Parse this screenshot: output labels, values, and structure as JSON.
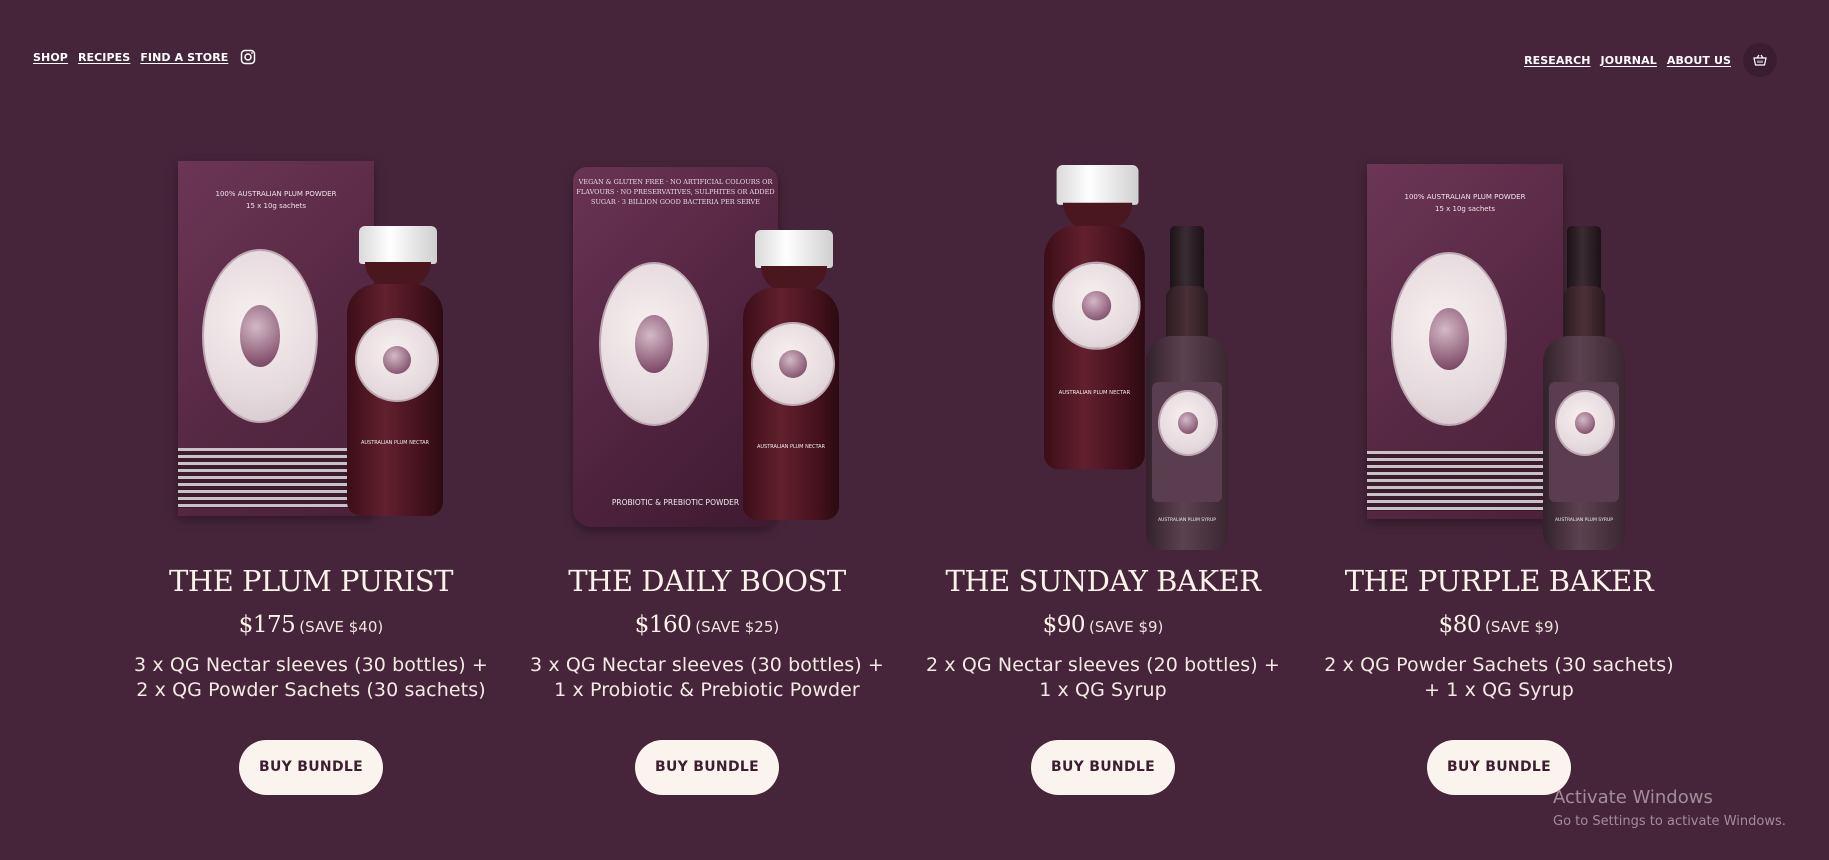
{
  "nav": {
    "left": [
      "SHOP",
      "RECIPES",
      "FIND A STORE"
    ],
    "right": [
      "RESEARCH",
      "JOURNAL",
      "ABOUT US"
    ],
    "instagram_icon": "instagram-icon",
    "cart_icon": "basket-icon"
  },
  "products": [
    {
      "title": "THE PLUM PURIST",
      "price": "$175",
      "save": "(SAVE $40)",
      "desc_line1": "3 x QG Nectar sleeves (30 bottles) +",
      "desc_line2": "2 x QG Powder Sachets (30 sachets)",
      "button": "BUY BUNDLE",
      "pack_text_1": "100% AUSTRALIAN PLUM POWDER",
      "pack_text_2": "15 x 10g sachets",
      "bottle_text": "AUSTRALIAN PLUM NECTAR"
    },
    {
      "title": "THE DAILY BOOST",
      "price": "$160",
      "save": "(SAVE $25)",
      "desc_line1": "3 x QG Nectar sleeves (30 bottles) +",
      "desc_line2": "1 x Probiotic & Prebiotic Powder",
      "button": "BUY BUNDLE",
      "pouch_text": "VEGAN & GLUTEN FREE · NO ARTIFICIAL COLOURS OR FLAVOURS · NO PRESERVATIVES, SULPHITES OR ADDED SUGAR · 3 BILLION GOOD BACTERIA PER SERVE",
      "pouch_footer": "PROBIOTIC & PREBIOTIC POWDER",
      "bottle_text": "AUSTRALIAN PLUM NECTAR"
    },
    {
      "title": "THE SUNDAY BAKER",
      "price": "$90",
      "save": "(SAVE $9)",
      "desc_line1": "2 x QG Nectar sleeves (20 bottles) +",
      "desc_line2": "1 x QG Syrup",
      "button": "BUY BUNDLE",
      "bottle_text": "AUSTRALIAN PLUM NECTAR",
      "syrup_text": "AUSTRALIAN PLUM SYRUP"
    },
    {
      "title": "THE PURPLE BAKER",
      "price": "$80",
      "save": "(SAVE $9)",
      "desc_line1": "2 x QG Powder Sachets (30 sachets)",
      "desc_line2": "+ 1 x QG Syrup",
      "button": "BUY BUNDLE",
      "pack_text_1": "100% AUSTRALIAN PLUM POWDER",
      "pack_text_2": "15 x 10g sachets",
      "syrup_text": "AUSTRALIAN PLUM SYRUP"
    }
  ],
  "watermark": {
    "line1": "Activate Windows",
    "line2": "Go to Settings to activate Windows."
  }
}
